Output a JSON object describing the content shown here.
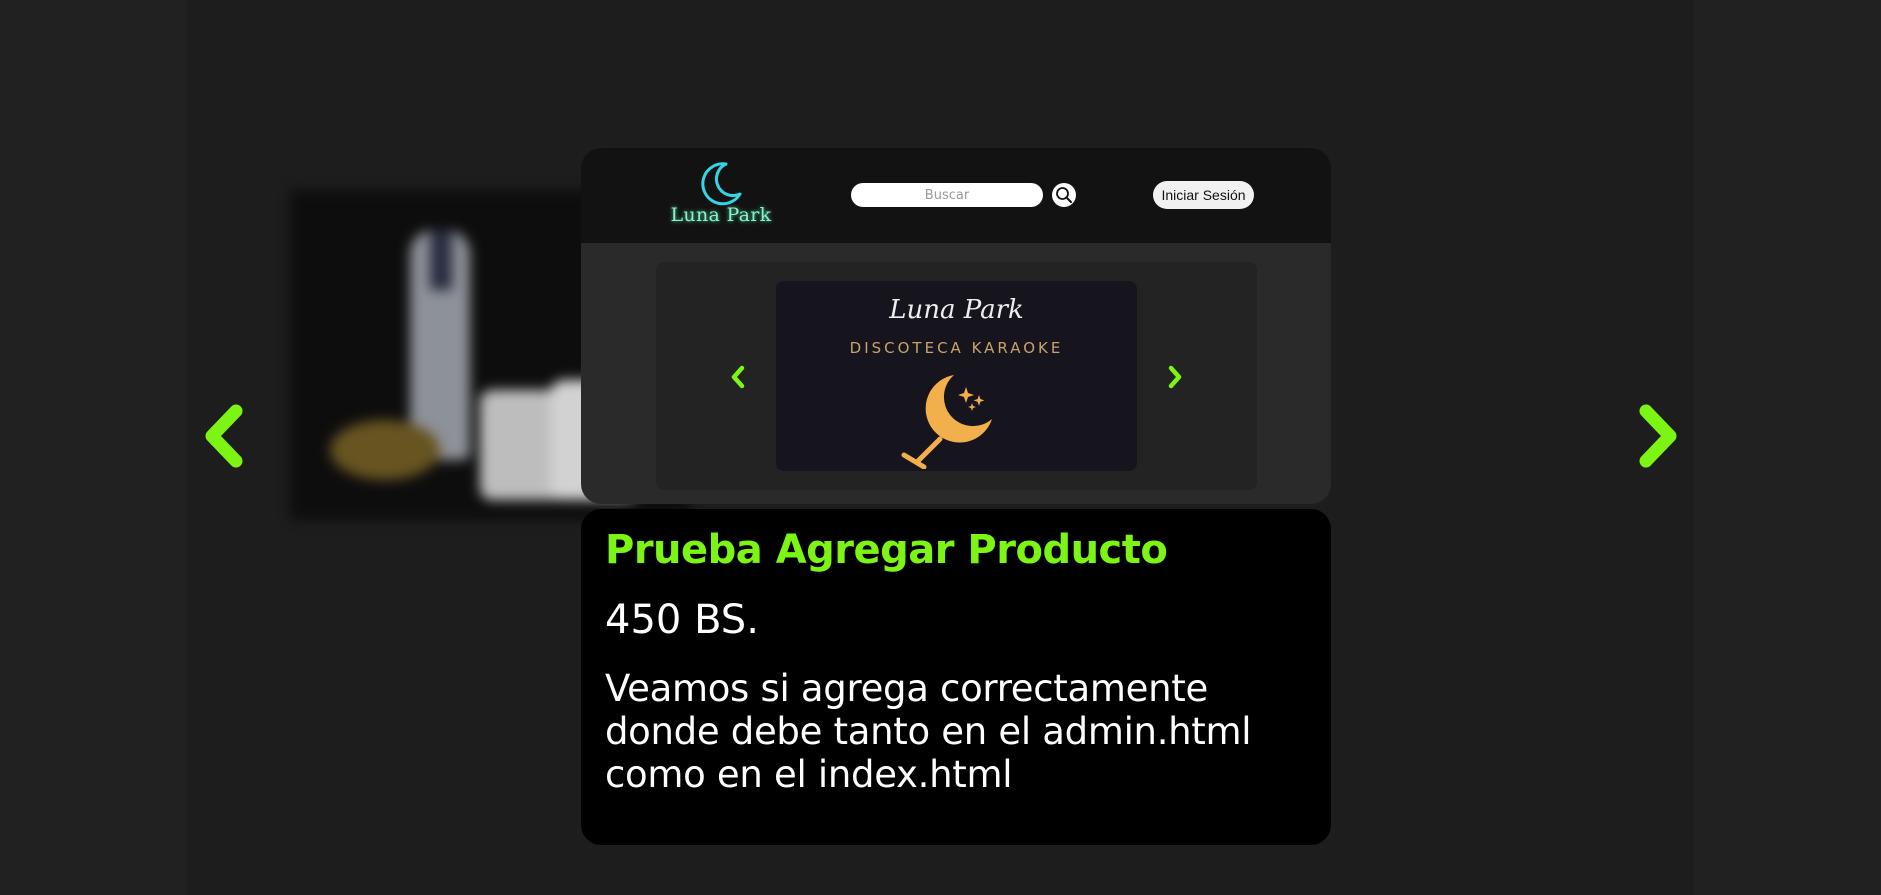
{
  "colors": {
    "accent": "#7cf515",
    "page_background": "#1d1d1d",
    "card_background": "#000000",
    "header_background": "#121212",
    "logo_glow": "#3fd7a0",
    "slide_gold": "#f2b04d"
  },
  "nav": {
    "prev_icon": "chevron-left-icon",
    "next_icon": "chevron-right-icon"
  },
  "preview": {
    "logo": {
      "text": "Luna Park",
      "icon": "moon-icon"
    },
    "search": {
      "placeholder": "Buscar",
      "value": "",
      "icon": "search-icon"
    },
    "login_label": "Iniciar Sesión",
    "carousel": {
      "slide_title": "Luna Park",
      "slide_subtitle": "DISCOTECA KARAOKE",
      "slide_icon": "moon-cocktail-glass-icon",
      "prev_icon": "chevron-left-icon",
      "next_icon": "chevron-right-icon"
    }
  },
  "product": {
    "name": "Prueba Agregar Producto",
    "price": "450 BS.",
    "description": "Veamos si agrega correctamente donde debe tanto en el admin.html como en el index.html"
  }
}
